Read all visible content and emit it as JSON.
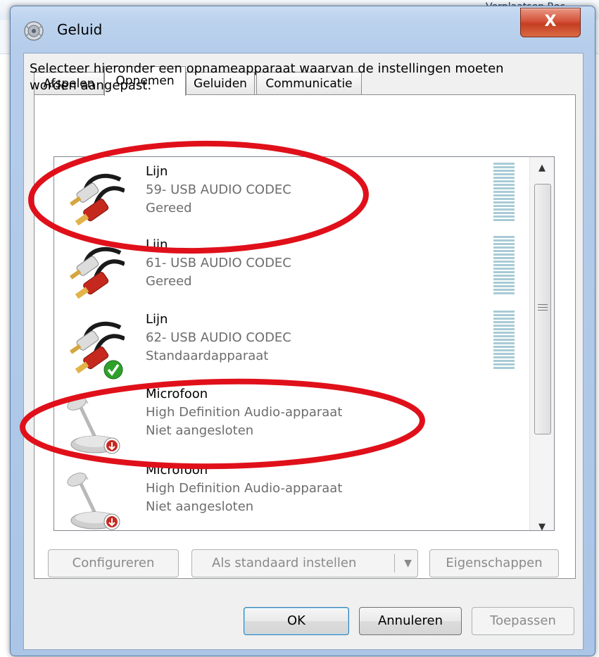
{
  "background": {
    "toolbar_fragment": "Verplaatsen Rec"
  },
  "window": {
    "title": "Geluid",
    "close_label": "X"
  },
  "tabs": [
    {
      "label": "Afspelen",
      "active": false
    },
    {
      "label": "Opnemen",
      "active": true
    },
    {
      "label": "Geluiden",
      "active": false
    },
    {
      "label": "Communicatie",
      "active": false
    }
  ],
  "instruction": "Selecteer hieronder een opnameapparaat waarvan de instellingen moeten worden aangepast:",
  "devices": [
    {
      "name": "Lijn",
      "device": "59- USB AUDIO  CODEC",
      "status": "Gereed",
      "icon": "rca-cable-icon",
      "default": false
    },
    {
      "name": "Lijn",
      "device": "61- USB AUDIO  CODEC",
      "status": "Gereed",
      "icon": "rca-cable-icon",
      "default": false
    },
    {
      "name": "Lijn",
      "device": "62- USB AUDIO  CODEC",
      "status": "Standaardapparaat",
      "icon": "rca-cable-icon",
      "default": true
    },
    {
      "name": "Microfoon",
      "device": "High Definition Audio-apparaat",
      "status": "Niet aangesloten",
      "icon": "microphone-icon",
      "default": false
    },
    {
      "name": "Microfoon",
      "device": "High Definition Audio-apparaat",
      "status": "Niet aangesloten",
      "icon": "microphone-icon",
      "default": false
    }
  ],
  "buttons": {
    "configure": "Configureren",
    "set_default": "Als standaard instellen",
    "properties": "Eigenschappen",
    "ok": "OK",
    "cancel": "Annuleren",
    "apply": "Toepassen"
  },
  "colors": {
    "annotation": "#e0101a",
    "meter": "#a8cbd6",
    "close_button": "#c53e22"
  }
}
